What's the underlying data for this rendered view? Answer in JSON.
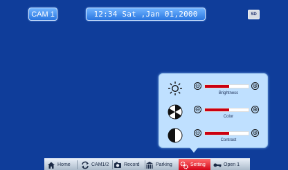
{
  "header": {
    "camera_label": "CAM 1",
    "datetime": "12:34 Sat ,Jan 01,2000",
    "sd_badge": "SD"
  },
  "settings_panel": {
    "rows": [
      {
        "label": "Brightness",
        "icon": "sun-icon",
        "level": 0.55
      },
      {
        "label": "Color",
        "icon": "color-wheel-icon",
        "level": 0.55
      },
      {
        "label": "Contrast",
        "icon": "contrast-icon",
        "level": 0.55
      }
    ],
    "minus_glyph": "⊖",
    "plus_glyph": "⊕"
  },
  "menu": {
    "items": [
      {
        "label": "Home",
        "icon": "home-icon"
      },
      {
        "label": "CAM1/2",
        "icon": "switch-camera-icon"
      },
      {
        "label": "Record",
        "icon": "record-icon"
      },
      {
        "label": "Parking",
        "icon": "parking-icon"
      },
      {
        "label": "Setting",
        "icon": "settings-icon",
        "active": true
      },
      {
        "label": "Open 1",
        "icon": "key-icon"
      }
    ]
  },
  "colors": {
    "background": "#0f3d9a",
    "accent": "#d20014",
    "pill": "#2a76e0"
  }
}
